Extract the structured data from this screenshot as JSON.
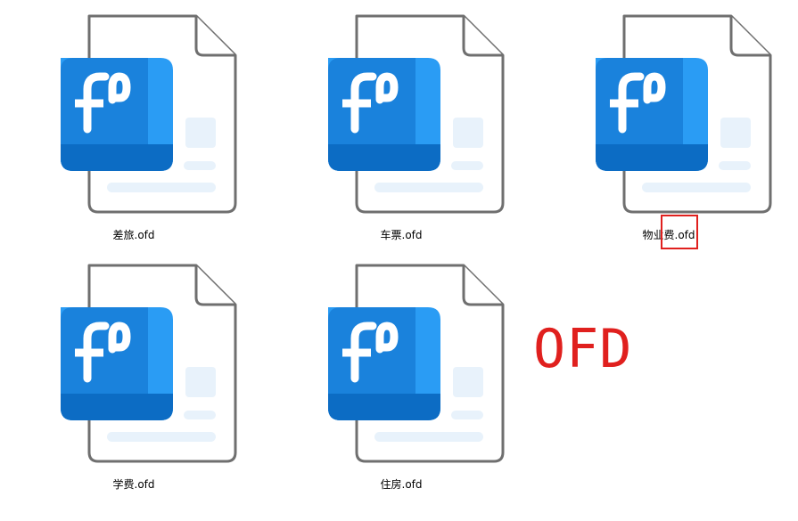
{
  "files": [
    {
      "name": "差旅.ofd",
      "icon": "ofd-file-icon"
    },
    {
      "name": "车票.ofd",
      "icon": "ofd-file-icon"
    },
    {
      "name": "物业费.ofd",
      "icon": "ofd-file-icon"
    },
    {
      "name": "学费.ofd",
      "icon": "ofd-file-icon"
    },
    {
      "name": "住房.ofd",
      "icon": "ofd-file-icon"
    }
  ],
  "annotation": {
    "text": "OFD",
    "color": "#e0201e"
  },
  "colors": {
    "icon_blue": "#1a7fd8",
    "icon_blue_light": "#2a9cf4",
    "icon_blue_dark": "#0c6cc4",
    "page_outline": "#6f6f6f",
    "page_placeholder": "#e8f2fb",
    "highlight": "#e0201e"
  }
}
